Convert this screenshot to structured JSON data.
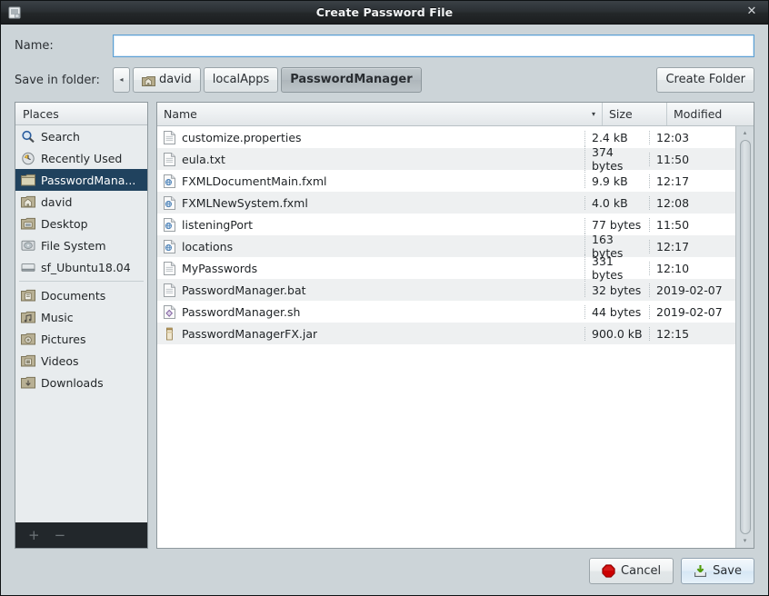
{
  "window": {
    "title": "Create Password File",
    "close_label": "✕",
    "icon": "window-icon"
  },
  "form": {
    "name_label": "Name:",
    "name_value": "",
    "name_placeholder": "",
    "folder_label": "Save in folder:",
    "create_folder_label": "Create Folder",
    "back_arrow": "◂",
    "breadcrumbs": [
      {
        "label": "david",
        "icon": "home-folder-icon",
        "active": false
      },
      {
        "label": "localApps",
        "icon": "",
        "active": false
      },
      {
        "label": "PasswordManager",
        "icon": "",
        "active": true
      }
    ]
  },
  "places": {
    "header": "Places",
    "add_label": "+",
    "remove_label": "−",
    "items": [
      {
        "label": "Search",
        "icon": "search-icon",
        "selected": false
      },
      {
        "label": "Recently Used",
        "icon": "clock-icon",
        "selected": false
      },
      {
        "label": "PasswordMana...",
        "icon": "folder-icon",
        "selected": true
      },
      {
        "label": "david",
        "icon": "home-folder-icon",
        "selected": false
      },
      {
        "label": "Desktop",
        "icon": "desktop-folder-icon",
        "selected": false
      },
      {
        "label": "File System",
        "icon": "drive-icon",
        "selected": false
      },
      {
        "label": "sf_Ubuntu18.04",
        "icon": "volume-icon",
        "selected": false
      },
      {
        "label": "Documents",
        "icon": "documents-folder-icon",
        "selected": false
      },
      {
        "label": "Music",
        "icon": "music-folder-icon",
        "selected": false
      },
      {
        "label": "Pictures",
        "icon": "pictures-folder-icon",
        "selected": false
      },
      {
        "label": "Videos",
        "icon": "videos-folder-icon",
        "selected": false
      },
      {
        "label": "Downloads",
        "icon": "downloads-folder-icon",
        "selected": false
      }
    ],
    "separator_after_index": 6
  },
  "filelist": {
    "columns": [
      "Name",
      "Size",
      "Modified"
    ],
    "sort_column": "Name",
    "sort_arrow": "▾",
    "rows": [
      {
        "name": "customize.properties",
        "size": "2.4 kB",
        "modified": "12:03",
        "icon": "text-file-icon"
      },
      {
        "name": "eula.txt",
        "size": "374 bytes",
        "modified": "11:50",
        "icon": "text-file-icon"
      },
      {
        "name": "FXMLDocumentMain.fxml",
        "size": "9.9 kB",
        "modified": "12:17",
        "icon": "xml-file-icon"
      },
      {
        "name": "FXMLNewSystem.fxml",
        "size": "4.0 kB",
        "modified": "12:08",
        "icon": "xml-file-icon"
      },
      {
        "name": "listeningPort",
        "size": "77 bytes",
        "modified": "11:50",
        "icon": "xml-file-icon"
      },
      {
        "name": "locations",
        "size": "163 bytes",
        "modified": "12:17",
        "icon": "xml-file-icon"
      },
      {
        "name": "MyPasswords",
        "size": "331 bytes",
        "modified": "12:10",
        "icon": "text-file-icon"
      },
      {
        "name": "PasswordManager.bat",
        "size": "32 bytes",
        "modified": "2019-02-07",
        "icon": "text-file-icon"
      },
      {
        "name": "PasswordManager.sh",
        "size": "44 bytes",
        "modified": "2019-02-07",
        "icon": "script-file-icon"
      },
      {
        "name": "PasswordManagerFX.jar",
        "size": "900.0 kB",
        "modified": "12:15",
        "icon": "jar-file-icon"
      }
    ],
    "scroll_up": "▴",
    "scroll_down": "▾"
  },
  "footer": {
    "cancel_label": "Cancel",
    "save_label": "Save",
    "cancel_icon": "stop-icon",
    "save_icon": "save-download-icon"
  },
  "colors": {
    "dialog_bg": "#ccd4d8",
    "selection": "#20425e",
    "titlebar": "#2b3034",
    "focus_border": "#5a9fd4",
    "cancel_red": "#cc0000",
    "save_green": "#4e9a06"
  }
}
